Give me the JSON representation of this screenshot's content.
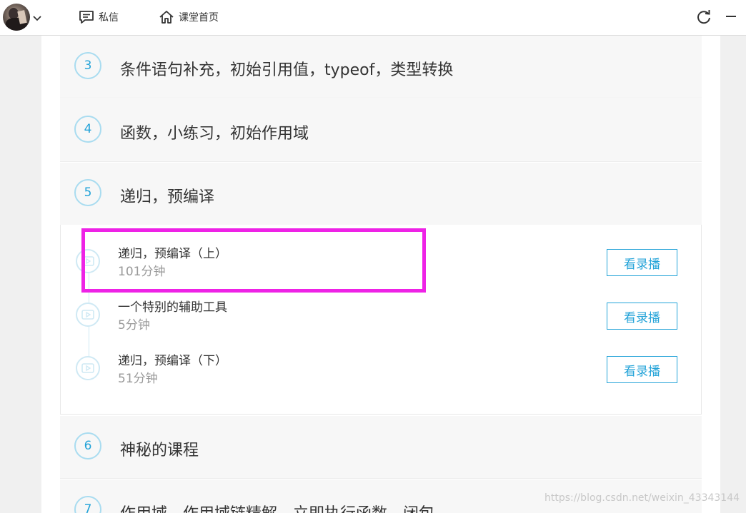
{
  "topbar": {
    "messages_label": "私信",
    "home_label": "课堂首页"
  },
  "sections": [
    {
      "num": "3",
      "title": "条件语句补充，初始引用值，typeof，类型转换"
    },
    {
      "num": "4",
      "title": "函数，小练习，初始作用域"
    },
    {
      "num": "5",
      "title": "递归，预编译"
    },
    {
      "num": "6",
      "title": "神秘的课程"
    },
    {
      "num": "7",
      "title": "作用域，作用域链精解，立即执行函数，闭包"
    }
  ],
  "lessons": [
    {
      "title": "递归，预编译（上）",
      "duration": "101分钟",
      "button": "看录播"
    },
    {
      "title": "一个特别的辅助工具",
      "duration": "5分钟",
      "button": "看录播"
    },
    {
      "title": "递归，预编译（下）",
      "duration": "51分钟",
      "button": "看录播"
    }
  ],
  "watermark": "https://blog.csdn.net/weixin_43343144",
  "colors": {
    "accent": "#23a3d8",
    "highlight": "#ee22e6"
  }
}
